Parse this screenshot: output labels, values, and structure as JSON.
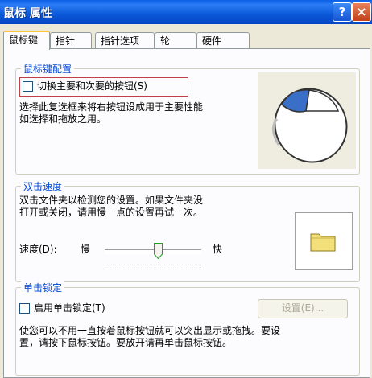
{
  "window": {
    "title": "鼠标 属性"
  },
  "titlebar_buttons": {
    "help": "?",
    "close": "×"
  },
  "tabs": [
    {
      "label": "鼠标键"
    },
    {
      "label": "指针"
    },
    {
      "label": "指针选项"
    },
    {
      "label": "轮"
    },
    {
      "label": "硬件"
    }
  ],
  "button_config": {
    "legend": "鼠标键配置",
    "checkbox_label": "切换主要和次要的按钮(S)",
    "checked": false,
    "description_line1": "选择此复选框来将右按钮设成用于主要性能",
    "description_line2": "如选择和拖放之用。"
  },
  "double_click": {
    "legend": "双击速度",
    "description_line1": "双击文件夹以检测您的设置。如果文件夹没",
    "description_line2": "打开或关闭，请用慢一点的设置再试一次。",
    "speed_label": "速度(D):",
    "slow_label": "慢",
    "fast_label": "快",
    "speed_level": 0.55
  },
  "click_lock": {
    "legend": "单击锁定",
    "checkbox_label": "启用单击锁定(T)",
    "checked": false,
    "settings_button": "设置(E)...",
    "description_line1": "使您可以不用一直按着鼠标按钮就可以突出显示或拖拽。要设",
    "description_line2": "置，请按下鼠标按钮。要放开请再单击鼠标按钮。"
  },
  "colors": {
    "title_bar": "#0A5FE6",
    "legend_text": "#0046D5",
    "accent_tab": "#FFC83C",
    "mouse_button": "#3A6FC8",
    "folder": "#F4E07A"
  },
  "icons": [
    "help-icon",
    "close-icon",
    "mouse-icon",
    "folder-icon",
    "slider-thumb-icon"
  ]
}
